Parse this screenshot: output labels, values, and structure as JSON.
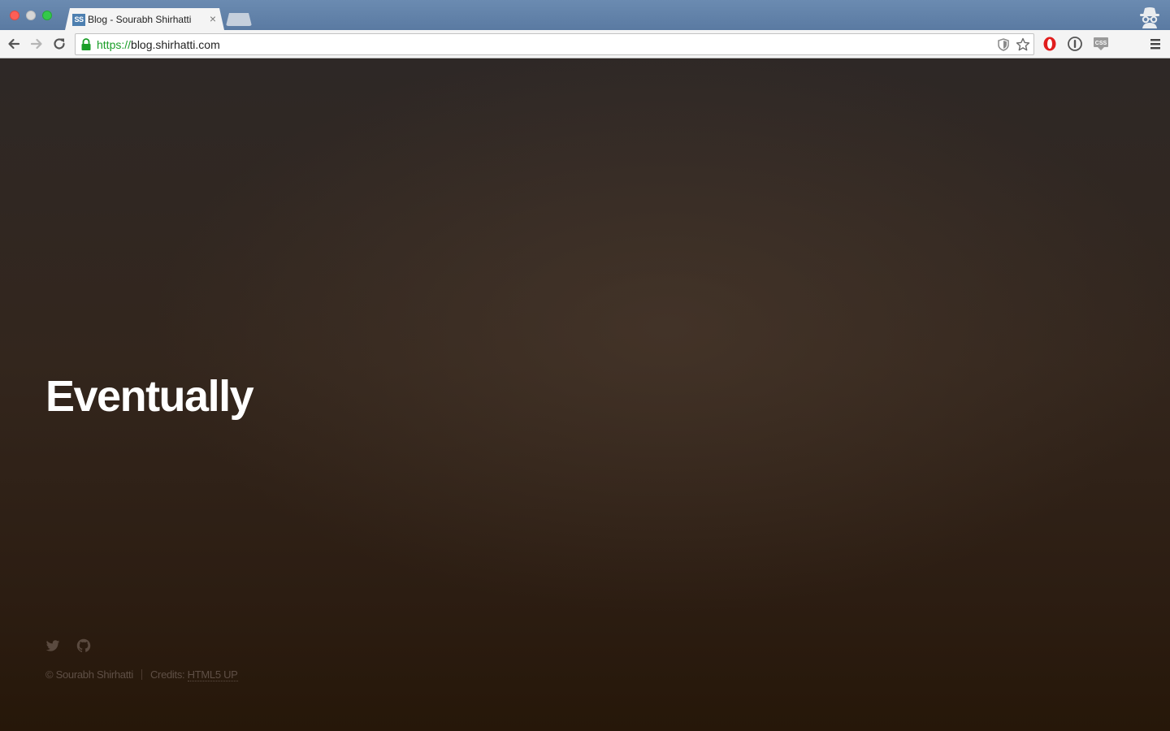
{
  "browser": {
    "tab": {
      "favicon_text": "SS",
      "title": "Blog - Sourabh Shirhatti",
      "close_label": "×"
    },
    "omnibox": {
      "scheme": "https://",
      "host": "blog.shirhatti.com"
    },
    "colors": {
      "titlebar": "#5a7aa2",
      "secure_green": "#1a9e28"
    }
  },
  "page": {
    "headline": "Eventually",
    "social": {
      "icons": [
        "twitter-icon",
        "github-icon"
      ]
    },
    "footer": {
      "copyright": "© Sourabh Shirhatti",
      "credits_prefix": "Credits: ",
      "credits_link": "HTML5 UP"
    },
    "colors": {
      "background_top": "#2e2826",
      "background_bottom": "#261709",
      "headline": "#ffffff",
      "muted_text": "#5e4f45"
    }
  }
}
